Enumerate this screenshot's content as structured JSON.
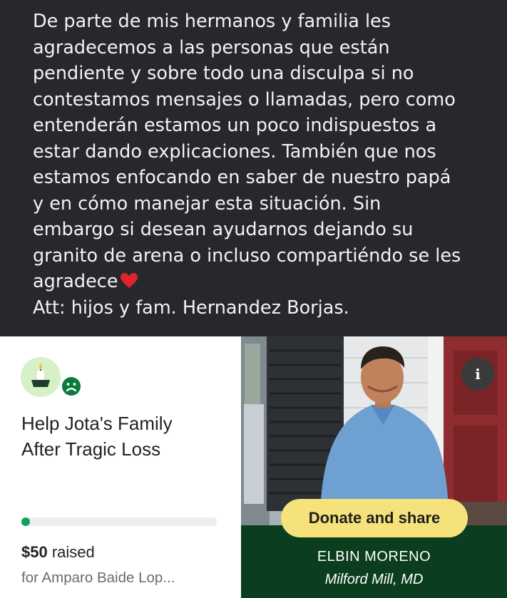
{
  "post": {
    "lines": [
      "De parte de mis hermanos y familia les",
      "agradecemos a las personas que están",
      "pendiente y sobre todo una disculpa si no",
      "contestamos mensajes o llamadas, pero como",
      "entenderán estamos un poco indispuestos a",
      "estar dando explicaciones. También que nos",
      "estamos enfocando en saber de nuestro papá",
      "y en cómo manejar esta situación. Sin",
      "embargo si desean ayudarnos dejando su",
      "granito de arena o incluso compartiéndo se les",
      "agradece",
      "Att: hijos y fam. Hernandez Borjas."
    ],
    "heart_icon": "red-heart-emoji",
    "heart_color": "#e0242c"
  },
  "card": {
    "title_line1": "Help Jota's Family",
    "title_line2": "After Tragic Loss",
    "progress_fraction": 0.02,
    "progress_color": "#0fa15b",
    "amount": "$50",
    "raised_label": " raised",
    "for_line": "for Amparo Baide Lop...",
    "info_label": "i",
    "donate_label": "Donate and share",
    "person_name": "ELBIN MORENO",
    "person_location": "Milford Mill, MD",
    "accent_yellow": "#f6e27a",
    "dark_green": "#0b3d1f"
  }
}
